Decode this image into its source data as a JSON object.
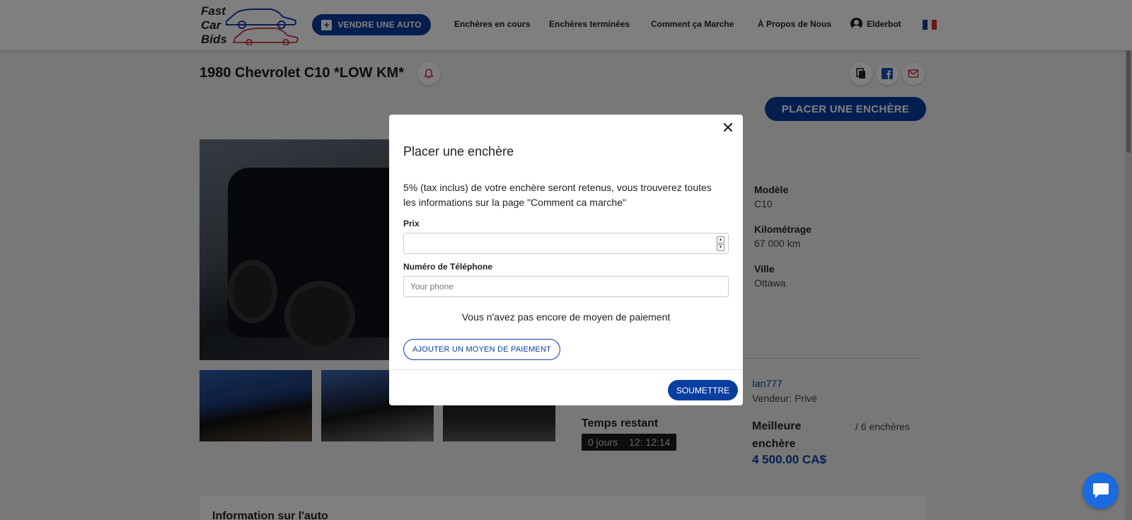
{
  "header": {
    "logo": {
      "line1": "Fast",
      "line2": "Car",
      "line3": "Bids"
    },
    "sell_button": "VENDRE UNE AUTO",
    "nav": [
      "Enchères en cours",
      "Enchères terminées",
      "Comment ça Marche",
      "À Propos de Nous"
    ],
    "user": "Elderbot",
    "flag_colors": [
      "#1f3f9b",
      "#ffffff",
      "#d62b36"
    ]
  },
  "listing": {
    "title": "1980 Chevrolet C10 *LOW KM*",
    "place_bid_button": "PLACER UNE ENCHÈRE",
    "specs": [
      {
        "label": "Modèle",
        "value": "C10"
      },
      {
        "label": "Kilométrage",
        "value": "67 000 km"
      },
      {
        "label": "Ville",
        "value": "Ottawa"
      }
    ],
    "seller": {
      "name": "Ian777",
      "type": "Vendeur: Privé"
    },
    "time_left_label": "Temps restant",
    "timer": {
      "days": "0 jours",
      "clock": "12: 12:14"
    },
    "best_bid_label": "Meilleure enchère",
    "bids_count": "/ 6 enchères",
    "best_bid_amount": "4 500.00 CA$",
    "info_title": "Information sur l'auto"
  },
  "modal": {
    "title": "Placer une enchère",
    "notice": "5% (tax inclus) de votre enchère seront retenus, vous trouverez toutes les informations sur la page \"Comment ca marche\"",
    "price_label": "Prix",
    "price_value": "",
    "phone_label": "Numéro de Téléphone",
    "phone_placeholder": "Your phone",
    "no_payment": "Vous n'avez pas encore de moyen de paiement",
    "add_payment_button": "AJOUTER UN MOYEN DE PAIEMENT",
    "submit_button": "SOUMETTRE"
  },
  "colors": {
    "primary": "#0a3da0",
    "chat": "#1b6be0"
  }
}
